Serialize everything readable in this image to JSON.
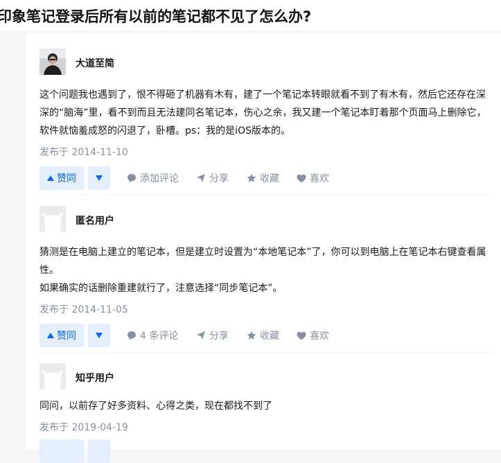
{
  "question": {
    "title": "印象笔记登录后所有以前的笔记都不见了怎么办?"
  },
  "answers": [
    {
      "author": "大道至简",
      "content": [
        "这个问题我也遇到了，恨不得砸了机器有木有，建了一个笔记本转眼就看不到了有木有，然后它还存在深深的“脑海”里，看不到而且无法建同名笔记本，伤心之余，我又建一个笔记本盯着那个页面马上删除它，软件就恼羞成怒的闪退了，卧槽。ps：我的是iOS版本的。"
      ],
      "date": "发布于 2014-11-10",
      "vote_label": "赞同",
      "comment_label": "添加评论",
      "share_label": "分享",
      "collect_label": "收藏",
      "like_label": "喜欢"
    },
    {
      "author": "匿名用户",
      "content": [
        "猜测是在电脑上建立的笔记本，但是建立时设置为“本地笔记本”了，你可以到电脑上在笔记本右键查看属性。",
        "如果确实的话删除重建就行了，注意选择“同步笔记本”。"
      ],
      "date": "发布于 2014-11-05",
      "vote_label": "赞同",
      "comment_label": "4 条评论",
      "share_label": "分享",
      "collect_label": "收藏",
      "like_label": "喜欢"
    },
    {
      "author": "知乎用户",
      "content": [
        "同问，以前存了好多资料、心得之类，现在都找不到了"
      ],
      "date": "发布于 2019-04-19"
    }
  ],
  "colors": {
    "accent": "#0066ff",
    "vote_bg": "#e5eefc",
    "muted": "#8590a6"
  }
}
